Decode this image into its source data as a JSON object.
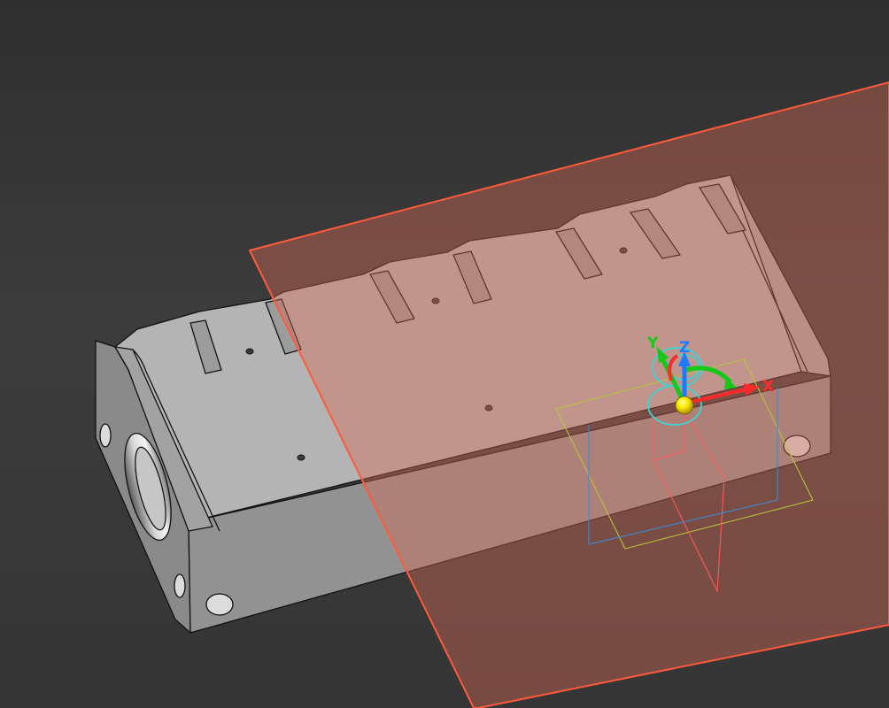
{
  "viewport": {
    "background_top": "#2f2f2f",
    "background_bottom": "#353535"
  },
  "model": {
    "body_color": "#9a9a9a",
    "edge_color": "#111111"
  },
  "section_plane": {
    "fill_color": "#d46a55",
    "edge_color": "#ff5a3c",
    "opacity": 0.42
  },
  "gizmo": {
    "x_label": "X",
    "y_label": "Y",
    "z_label": "Z",
    "x_color": "#ff2a2a",
    "y_color": "#17c917",
    "z_color": "#1e7bff",
    "ring_color": "#3ad6d6",
    "origin_color": "#ffee00"
  }
}
